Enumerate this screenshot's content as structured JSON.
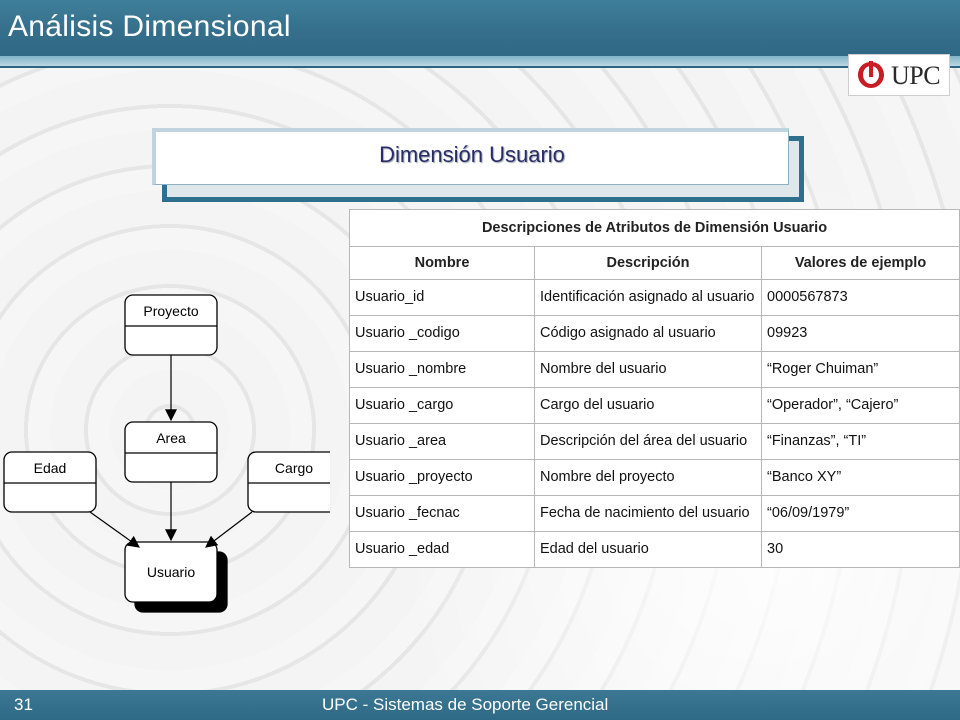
{
  "header": {
    "title": "Análisis Dimensional",
    "logo_text": "UPC"
  },
  "section": {
    "title": "Dimensión Usuario"
  },
  "table": {
    "caption": "Descripciones de Atributos de Dimensión Usuario",
    "columns": [
      "Nombre",
      "Descripción",
      "Valores de ejemplo"
    ],
    "rows": [
      {
        "nombre": "Usuario_id",
        "descripcion": "Identificación asignado al usuario",
        "valores": "0000567873"
      },
      {
        "nombre": "Usuario _codigo",
        "descripcion": "Código asignado al usuario",
        "valores": "09923"
      },
      {
        "nombre": "Usuario _nombre",
        "descripcion": "Nombre del usuario",
        "valores": "“Roger Chuiman”"
      },
      {
        "nombre": "Usuario _cargo",
        "descripcion": "Cargo del usuario",
        "valores": "“Operador”, “Cajero”"
      },
      {
        "nombre": "Usuario _area",
        "descripcion": "Descripción del área del usuario",
        "valores": "“Finanzas”, “TI”"
      },
      {
        "nombre": "Usuario _proyecto",
        "descripcion": "Nombre del proyecto",
        "valores": "“Banco XY”"
      },
      {
        "nombre": "Usuario _fecnac",
        "descripcion": "Fecha de nacimiento del usuario",
        "valores": "“06/09/1979”"
      },
      {
        "nombre": "Usuario _edad",
        "descripcion": "Edad del usuario",
        "valores": "30"
      }
    ]
  },
  "diagram": {
    "nodes": {
      "proyecto": "Proyecto",
      "area": "Area",
      "edad": "Edad",
      "cargo": "Cargo",
      "usuario": "Usuario"
    }
  },
  "footer": {
    "page_number": "31",
    "text": "UPC - Sistemas de Soporte Gerencial"
  },
  "colors": {
    "header_bar": "#356f8b",
    "title_text": "#2b2b6a",
    "footer_bar": "#2e6a86"
  }
}
